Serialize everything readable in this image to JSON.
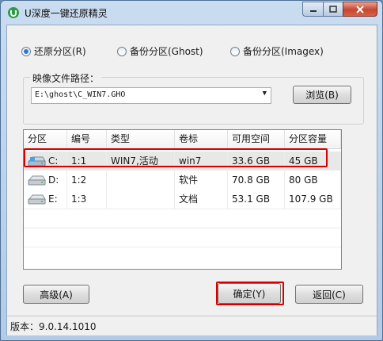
{
  "window": {
    "title": "U深度一键还原精灵"
  },
  "modes": [
    {
      "label": "还原分区(R)",
      "selected": true
    },
    {
      "label": "备份分区(Ghost)",
      "selected": false
    },
    {
      "label": "备份分区(Imagex)",
      "selected": false
    }
  ],
  "image_path": {
    "label": "映像文件路径：",
    "value": "E:\\ghost\\C_WIN7.GHO",
    "browse_label": "浏览(B)"
  },
  "table": {
    "columns": [
      "分区",
      "编号",
      "类型",
      "卷标",
      "可用空间",
      "分区容量"
    ],
    "rows": [
      {
        "drive": "C:",
        "id": "1:1",
        "type": "WIN7,活动",
        "label": "win7",
        "free": "33.6 GB",
        "size": "45 GB",
        "selected": true,
        "icon": "system-drive-icon"
      },
      {
        "drive": "D:",
        "id": "1:2",
        "type": "",
        "label": "软件",
        "free": "70.8 GB",
        "size": "80 GB",
        "selected": false,
        "icon": "hard-drive-icon"
      },
      {
        "drive": "E:",
        "id": "1:3",
        "type": "",
        "label": "文档",
        "free": "53.1 GB",
        "size": "107.9 GB",
        "selected": false,
        "icon": "hard-drive-icon"
      }
    ]
  },
  "buttons": {
    "advanced": "高级(A)",
    "ok": "确定(Y)",
    "back": "返回(C)"
  },
  "status": {
    "version": "版本：9.0.14.1010"
  },
  "colors": {
    "highlight": "#d60000",
    "accent": "#2a7ad6"
  }
}
